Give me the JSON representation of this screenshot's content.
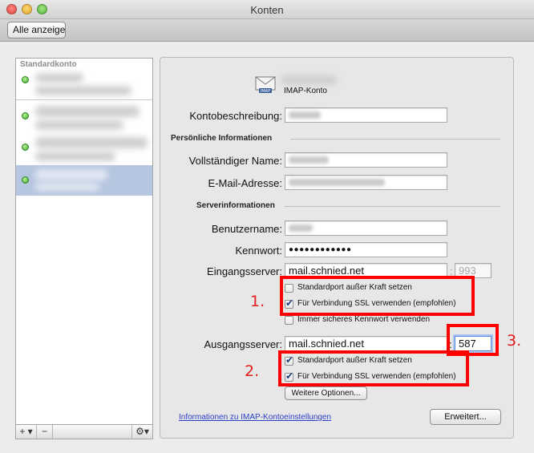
{
  "window": {
    "title": "Konten"
  },
  "toolbar": {
    "show_all_label": "Alle anzeigen"
  },
  "sidebar": {
    "header": "Standardkonto",
    "accounts": [
      {
        "status": "online"
      },
      {
        "status": "online"
      },
      {
        "status": "online"
      },
      {
        "status": "online",
        "selected": true
      }
    ],
    "bottom_buttons": {
      "add": "+ ▾",
      "remove": "−",
      "gear": "⚙▾"
    }
  },
  "panel": {
    "account_type": "IMAP-Konto",
    "labels": {
      "description": "Kontobeschreibung:",
      "full_name": "Vollständiger Name:",
      "email": "E-Mail-Adresse:",
      "username": "Benutzername:",
      "password": "Kennwort:",
      "incoming": "Eingangsserver:",
      "outgoing": "Ausgangsserver:"
    },
    "sections": {
      "personal": "Persönliche Informationen",
      "server": "Serverinformationen"
    },
    "values": {
      "password": "●●●●●●●●●●●●",
      "incoming_server": "mail.schnied.net",
      "incoming_port": "993",
      "outgoing_server": "mail.schnied.net",
      "outgoing_port": "587"
    },
    "incoming_options": {
      "override_port": {
        "label": "Standardport außer Kraft setzen",
        "checked": false
      },
      "use_ssl": {
        "label": "Für Verbindung SSL verwenden (empfohlen)",
        "checked": true
      },
      "secure_password": {
        "label": "Immer sicheres Kennwort verwenden",
        "checked": false
      }
    },
    "outgoing_options": {
      "override_port": {
        "label": "Standardport außer Kraft setzen",
        "checked": true
      },
      "use_ssl": {
        "label": "Für Verbindung SSL verwenden (empfohlen)",
        "checked": true
      }
    },
    "more_options_button": "Weitere Optionen...",
    "info_link": "Informationen zu IMAP-Kontoeinstellungen",
    "advanced_button": "Erweitert..."
  },
  "annotations": {
    "num1": "1.",
    "num2": "2.",
    "num3": "3.",
    "color": "#ff0000"
  }
}
